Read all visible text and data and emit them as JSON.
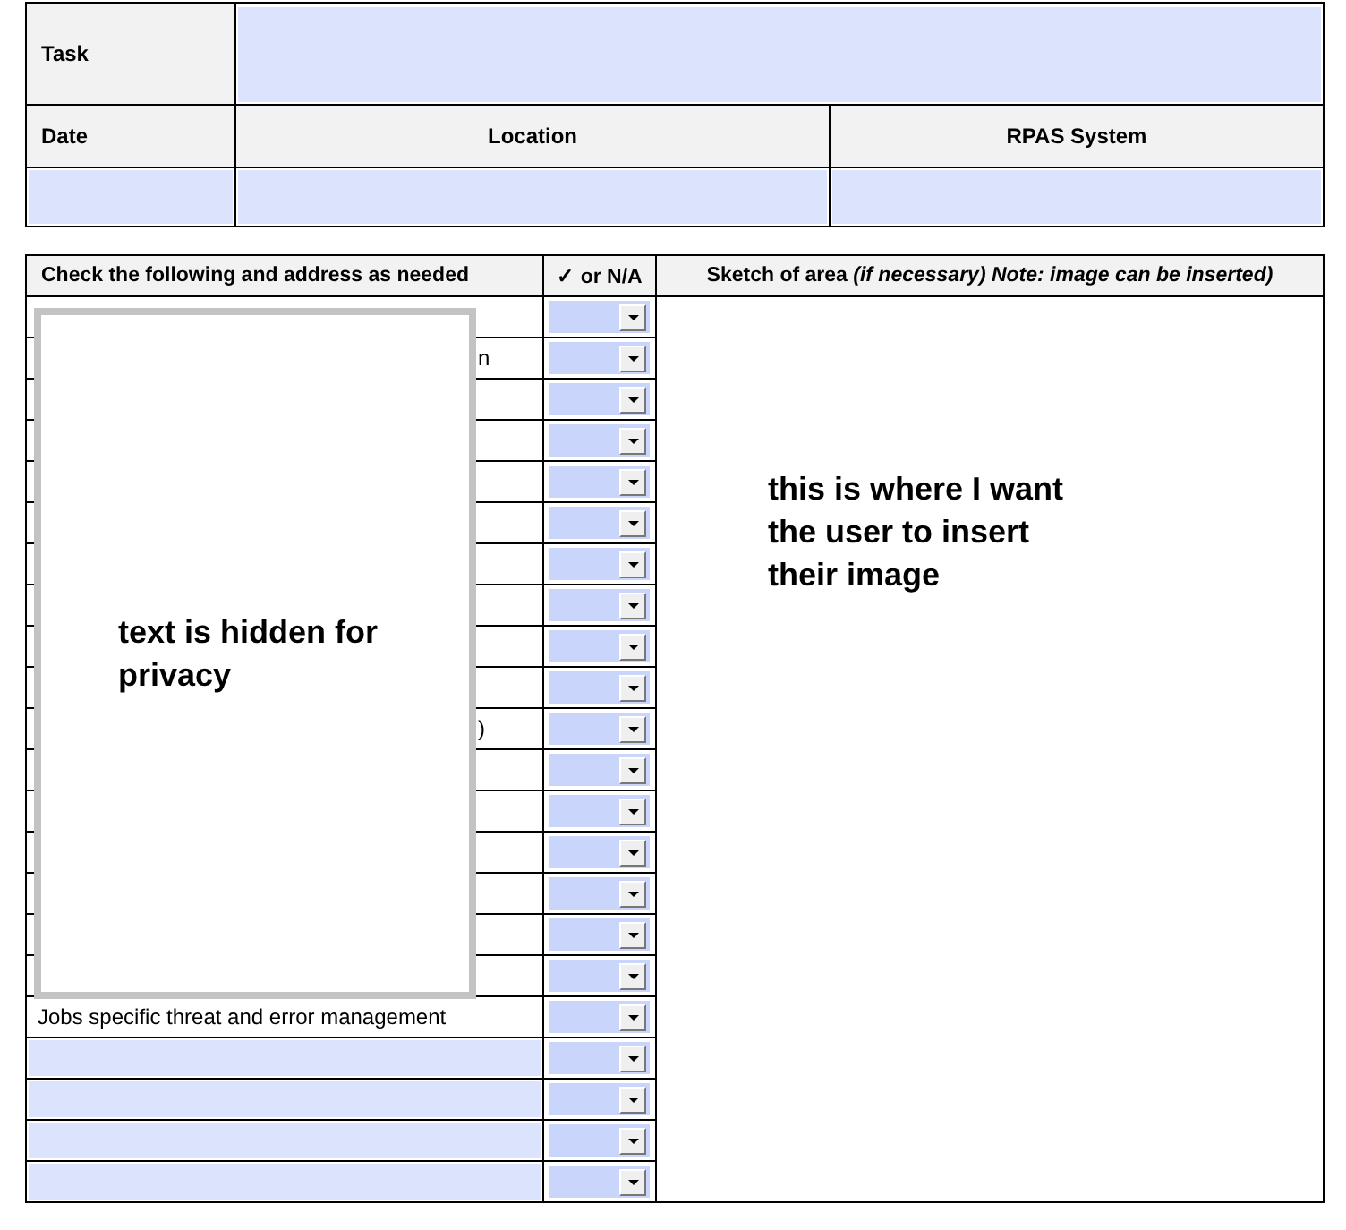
{
  "task": {
    "label": "Task"
  },
  "info_headers": [
    "Date",
    "Location",
    "RPAS System"
  ],
  "checklist": {
    "headers": [
      {
        "kind": "items",
        "text": "Check the following and address as needed"
      },
      {
        "kind": "check",
        "text": "✓ or N/A"
      },
      {
        "kind": "sketch",
        "text": "Sketch of area *(if necessary) Note: image can be inserted)*"
      }
    ],
    "rows": [
      {
        "kind": "text"
      },
      {
        "kind": "fragment",
        "text": "n"
      },
      {
        "kind": "text"
      },
      {
        "kind": "text"
      },
      {
        "kind": "text"
      },
      {
        "kind": "text"
      },
      {
        "kind": "text"
      },
      {
        "kind": "text"
      },
      {
        "kind": "text"
      },
      {
        "kind": "text"
      },
      {
        "kind": "fragment",
        "text": ")"
      },
      {
        "kind": "text"
      },
      {
        "kind": "text"
      },
      {
        "kind": "text"
      },
      {
        "kind": "text"
      },
      {
        "kind": "text"
      },
      {
        "kind": "text"
      },
      {
        "kind": "text",
        "text": "Jobs specific threat and error management"
      },
      {
        "kind": "field"
      },
      {
        "kind": "field"
      },
      {
        "kind": "field"
      },
      {
        "kind": "field"
      }
    ],
    "sketch_note": "this is where I want the user to insert their image"
  },
  "privacy_overlay": {
    "text": "text is hidden for privacy"
  }
}
